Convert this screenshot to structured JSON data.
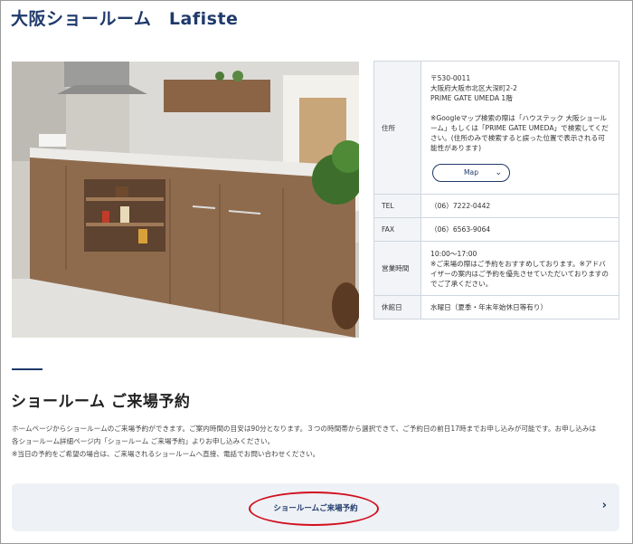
{
  "showroom": {
    "title": "大阪ショールーム　Lafiste"
  },
  "info": {
    "address_label": "住所",
    "address_lines": [
      "〒530-0011",
      "大阪府大阪市北区大深町2-2",
      "PRIME GATE UMEDA 1階"
    ],
    "address_note": "※Googleマップ検索の際は「ハウステック 大阪ショールーム」もしくは「PRIME GATE UMEDA」で検索してください。(住所のみで検索すると誤った位置で表示される可能性があります)",
    "map_button": "Map",
    "tel_label": "TEL",
    "tel_value": "（06）7222-0442",
    "fax_label": "FAX",
    "fax_value": "（06）6563-9064",
    "hours_label": "営業時間",
    "hours_time": "10:00～17:00",
    "hours_note": "※ご来場の際はご予約をおすすめしております。※アドバイザーの案内はご予約を優先させていただいておりますのでご了承ください。",
    "closed_label": "休館日",
    "closed_value": "水曜日（夏季・年末年始休日等有り）"
  },
  "reservation": {
    "heading": "ショールーム ご来場予約",
    "text_1": "ホームページからショールームのご来場予約ができます。ご案内時間の目安は90分となります。３つの時間帯から選択できて、ご予約日の前日17時までお申し込みが可能です。お申し込みは",
    "text_2": "各ショールーム詳細ページ内「ショールーム ご来場予約」よりお申し込みください。",
    "text_3": "※当日の予約をご希望の場合は、ご来場されるショールームへ直接、電話でお問い合わせください。",
    "button": "ショールームご来場予約"
  },
  "colors": {
    "navy": "#1f3a6b",
    "highlight": "#d10f1f"
  },
  "icons": {
    "map_chevron": "chevron-down-icon",
    "reserve_chevron": "chevron-right-icon"
  }
}
